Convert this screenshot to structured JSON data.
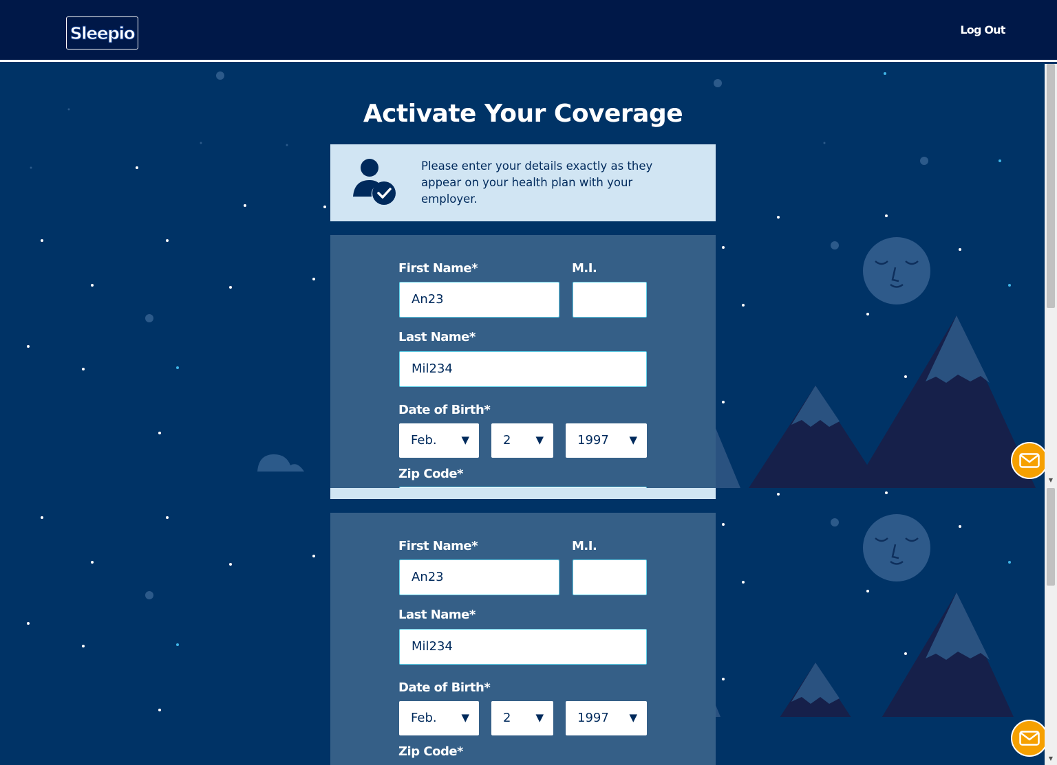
{
  "header": {
    "logo_text": "Sleepio",
    "logout_label": "Log Out"
  },
  "title": "Activate Your Coverage",
  "info": {
    "text": "Please enter your details exactly as they appear on your health plan with your employer."
  },
  "form": {
    "first_name_label": "First Name*",
    "first_name_value": "An23",
    "mi_label": "M.I.",
    "mi_value": "",
    "last_name_label": "Last Name*",
    "last_name_value": "Mil234",
    "dob_label": "Date of Birth*",
    "dob_month": "Feb.",
    "dob_day": "2",
    "dob_year": "1997",
    "zip_label": "Zip Code*"
  },
  "icons": [
    "user-check-icon",
    "envelope-icon",
    "moon-face-icon",
    "chevron-down-icon"
  ],
  "colors": {
    "header_bg": "#001848",
    "page_bg": "#003366",
    "info_bg": "#d1e5f3",
    "form_bg": "#355f87",
    "input_border": "#5fd0e8",
    "accent_orange": "#f6a000",
    "text_dark": "#002a5c"
  }
}
